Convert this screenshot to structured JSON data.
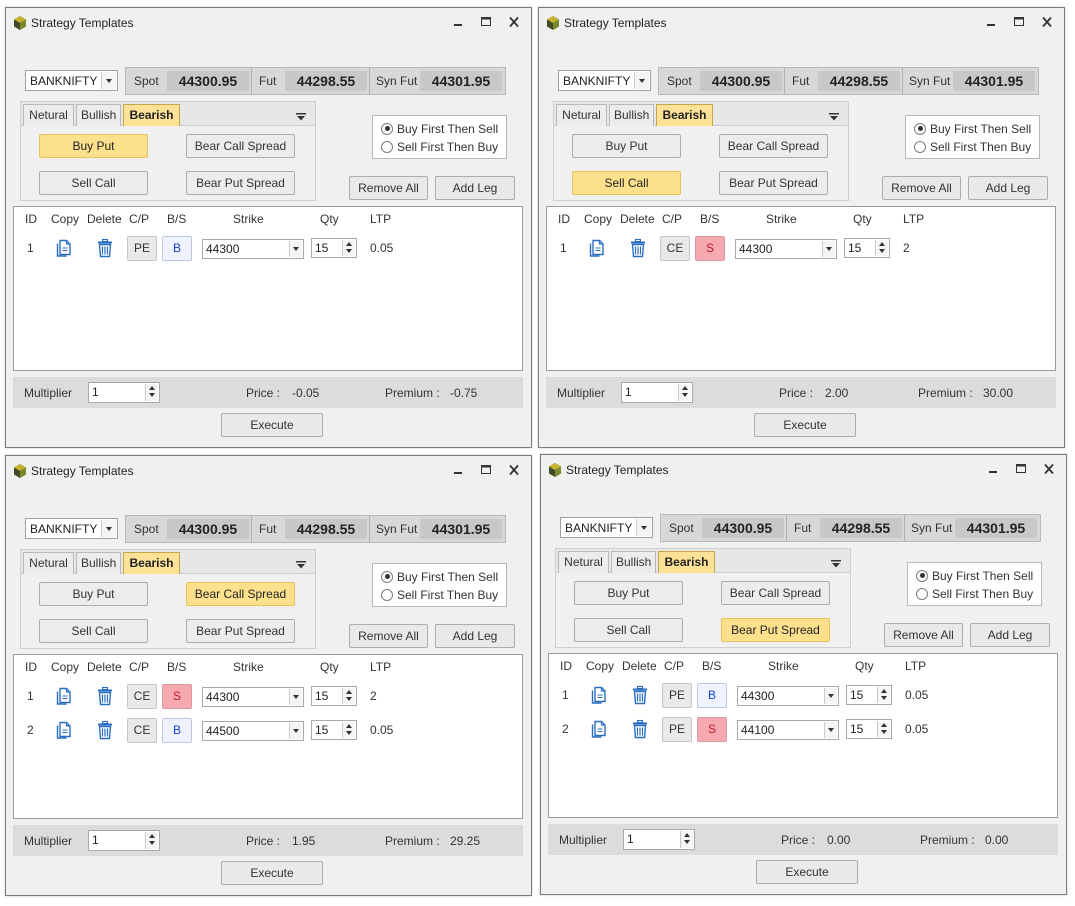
{
  "windows": [
    {
      "title": "Strategy Templates",
      "symbol": "BANKNIFTY",
      "quotes": {
        "spot_label": "Spot",
        "spot": "44300.95",
        "fut_label": "Fut",
        "fut": "44298.55",
        "synfut_label": "Syn Fut",
        "synfut": "44301.95"
      },
      "tabs": [
        {
          "label": "Netural",
          "active": false
        },
        {
          "label": "Bullish",
          "active": false
        },
        {
          "label": "Bearish",
          "active": true
        }
      ],
      "strategy_buttons": [
        {
          "label": "Buy Put",
          "active": true
        },
        {
          "label": "Bear Call Spread",
          "active": false
        },
        {
          "label": "Sell Call",
          "active": false
        },
        {
          "label": "Bear Put Spread",
          "active": false
        }
      ],
      "order_mode": {
        "options": [
          "Buy First Then Sell",
          "Sell First Then Buy"
        ],
        "selected": 0
      },
      "remove_leg": "Remove All",
      "add_leg": "Add Leg",
      "grid_headers": {
        "id": "ID",
        "copy": "Copy",
        "delete": "Delete",
        "cp": "C/P",
        "bs": "B/S",
        "strike": "Strike",
        "qty": "Qty",
        "ltp": "LTP"
      },
      "legs": [
        {
          "id": "1",
          "cp": "PE",
          "bs": "B",
          "strike": "44300",
          "qty": "15",
          "ltp": "0.05"
        }
      ],
      "footer": {
        "multiplier_label": "Multiplier",
        "multiplier": "1",
        "price_label": "Price :",
        "price": "-0.05",
        "premium_label": "Premium :",
        "premium": "-0.75"
      },
      "execute": "Execute"
    },
    {
      "title": "Strategy Templates",
      "symbol": "BANKNIFTY",
      "quotes": {
        "spot_label": "Spot",
        "spot": "44300.95",
        "fut_label": "Fut",
        "fut": "44298.55",
        "synfut_label": "Syn Fut",
        "synfut": "44301.95"
      },
      "tabs": [
        {
          "label": "Netural",
          "active": false
        },
        {
          "label": "Bullish",
          "active": false
        },
        {
          "label": "Bearish",
          "active": true
        }
      ],
      "strategy_buttons": [
        {
          "label": "Buy Put",
          "active": false
        },
        {
          "label": "Bear Call Spread",
          "active": false
        },
        {
          "label": "Sell Call",
          "active": true
        },
        {
          "label": "Bear Put Spread",
          "active": false
        }
      ],
      "order_mode": {
        "options": [
          "Buy First Then Sell",
          "Sell First Then Buy"
        ],
        "selected": 0
      },
      "remove_leg": "Remove All",
      "add_leg": "Add Leg",
      "grid_headers": {
        "id": "ID",
        "copy": "Copy",
        "delete": "Delete",
        "cp": "C/P",
        "bs": "B/S",
        "strike": "Strike",
        "qty": "Qty",
        "ltp": "LTP"
      },
      "legs": [
        {
          "id": "1",
          "cp": "CE",
          "bs": "S",
          "strike": "44300",
          "qty": "15",
          "ltp": "2"
        }
      ],
      "footer": {
        "multiplier_label": "Multiplier",
        "multiplier": "1",
        "price_label": "Price :",
        "price": "2.00",
        "premium_label": "Premium :",
        "premium": "30.00"
      },
      "execute": "Execute"
    },
    {
      "title": "Strategy Templates",
      "symbol": "BANKNIFTY",
      "quotes": {
        "spot_label": "Spot",
        "spot": "44300.95",
        "fut_label": "Fut",
        "fut": "44298.55",
        "synfut_label": "Syn Fut",
        "synfut": "44301.95"
      },
      "tabs": [
        {
          "label": "Netural",
          "active": false
        },
        {
          "label": "Bullish",
          "active": false
        },
        {
          "label": "Bearish",
          "active": true
        }
      ],
      "strategy_buttons": [
        {
          "label": "Buy Put",
          "active": false
        },
        {
          "label": "Bear Call Spread",
          "active": true
        },
        {
          "label": "Sell Call",
          "active": false
        },
        {
          "label": "Bear Put Spread",
          "active": false
        }
      ],
      "order_mode": {
        "options": [
          "Buy First Then Sell",
          "Sell First Then Buy"
        ],
        "selected": 0
      },
      "remove_leg": "Remove All",
      "add_leg": "Add Leg",
      "grid_headers": {
        "id": "ID",
        "copy": "Copy",
        "delete": "Delete",
        "cp": "C/P",
        "bs": "B/S",
        "strike": "Strike",
        "qty": "Qty",
        "ltp": "LTP"
      },
      "legs": [
        {
          "id": "1",
          "cp": "CE",
          "bs": "S",
          "strike": "44300",
          "qty": "15",
          "ltp": "2"
        },
        {
          "id": "2",
          "cp": "CE",
          "bs": "B",
          "strike": "44500",
          "qty": "15",
          "ltp": "0.05"
        }
      ],
      "footer": {
        "multiplier_label": "Multiplier",
        "multiplier": "1",
        "price_label": "Price :",
        "price": "1.95",
        "premium_label": "Premium :",
        "premium": "29.25"
      },
      "execute": "Execute"
    },
    {
      "title": "Strategy Templates",
      "symbol": "BANKNIFTY",
      "quotes": {
        "spot_label": "Spot",
        "spot": "44300.95",
        "fut_label": "Fut",
        "fut": "44298.55",
        "synfut_label": "Syn Fut",
        "synfut": "44301.95"
      },
      "tabs": [
        {
          "label": "Netural",
          "active": false
        },
        {
          "label": "Bullish",
          "active": false
        },
        {
          "label": "Bearish",
          "active": true
        }
      ],
      "strategy_buttons": [
        {
          "label": "Buy Put",
          "active": false
        },
        {
          "label": "Bear Call Spread",
          "active": false
        },
        {
          "label": "Sell Call",
          "active": false
        },
        {
          "label": "Bear Put Spread",
          "active": true
        }
      ],
      "order_mode": {
        "options": [
          "Buy First Then Sell",
          "Sell First Then Buy"
        ],
        "selected": 0
      },
      "remove_leg": "Remove All",
      "add_leg": "Add Leg",
      "grid_headers": {
        "id": "ID",
        "copy": "Copy",
        "delete": "Delete",
        "cp": "C/P",
        "bs": "B/S",
        "strike": "Strike",
        "qty": "Qty",
        "ltp": "LTP"
      },
      "legs": [
        {
          "id": "1",
          "cp": "PE",
          "bs": "B",
          "strike": "44300",
          "qty": "15",
          "ltp": "0.05"
        },
        {
          "id": "2",
          "cp": "PE",
          "bs": "S",
          "strike": "44100",
          "qty": "15",
          "ltp": "0.05"
        }
      ],
      "footer": {
        "multiplier_label": "Multiplier",
        "multiplier": "1",
        "price_label": "Price :",
        "price": "0.00",
        "premium_label": "Premium :",
        "premium": "0.00"
      },
      "execute": "Execute"
    }
  ]
}
